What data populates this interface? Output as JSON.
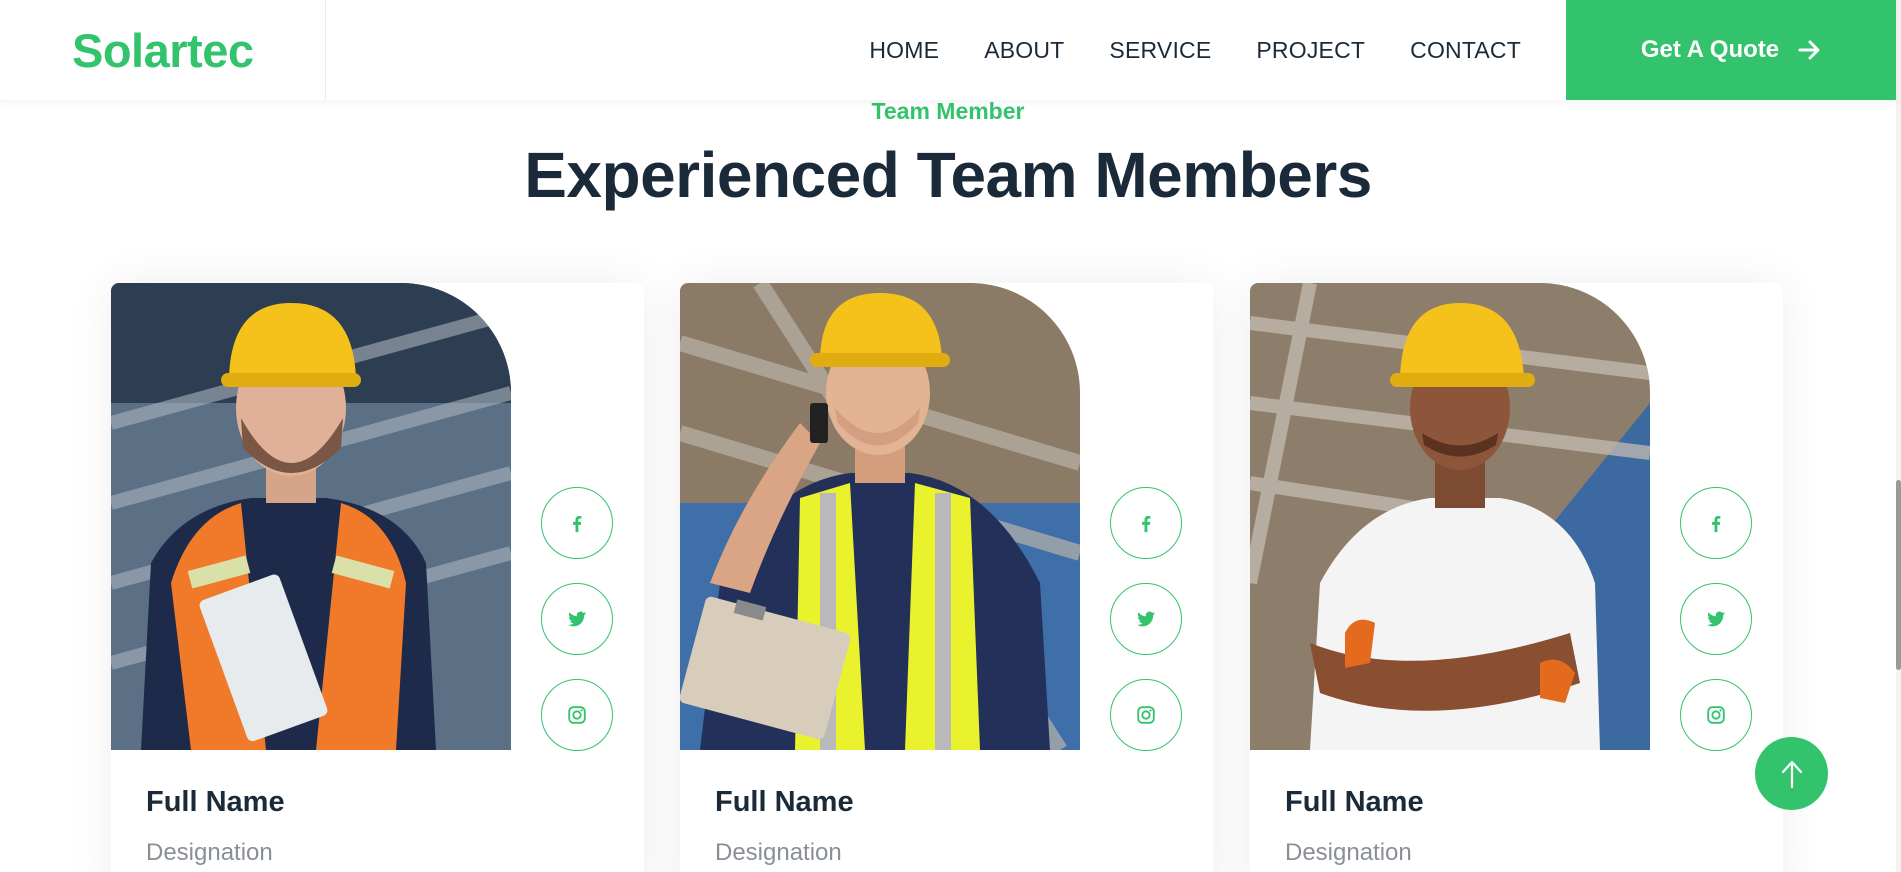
{
  "brand": {
    "name": "Solartec"
  },
  "nav": {
    "links": [
      "HOME",
      "ABOUT",
      "SERVICE",
      "PROJECT",
      "CONTACT"
    ],
    "cta_label": "Get A Quote",
    "cta_icon": "arrow-right-icon"
  },
  "section": {
    "eyebrow": "Team Member",
    "title": "Experienced Team Members"
  },
  "team": [
    {
      "name": "Full Name",
      "designation": "Designation"
    },
    {
      "name": "Full Name",
      "designation": "Designation"
    },
    {
      "name": "Full Name",
      "designation": "Designation"
    }
  ],
  "social_icons": [
    "facebook-icon",
    "twitter-icon",
    "instagram-icon"
  ],
  "back_to_top_icon": "arrow-up-icon",
  "colors": {
    "accent": "#32c36c",
    "heading": "#1b2a38",
    "muted": "#8a8f96",
    "background": "#ffffff"
  }
}
